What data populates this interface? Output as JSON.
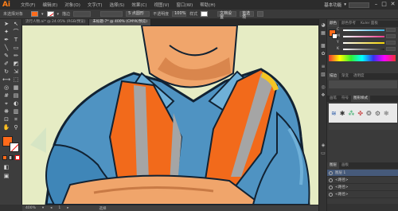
{
  "app": {
    "logo": "Ai"
  },
  "menubar": {
    "items": [
      "文件(F)",
      "编辑(E)",
      "对象(O)",
      "文字(T)",
      "选择(S)",
      "效果(C)",
      "视图(V)",
      "窗口(W)",
      "帮助(H)"
    ],
    "workspace": "基本功能",
    "minimize": "–",
    "maximize": "□",
    "close": "✕"
  },
  "controlbar": {
    "selection_label": "未选择对象",
    "stroke_label": "描边",
    "stroke_width": "",
    "points": "5 点圆形",
    "opacity_label": "不透明度",
    "opacity_value": "100%",
    "style_label": "样式",
    "doc_setup": "文档设置",
    "prefs": "首选项",
    "colors": {
      "fill": "#ff6a1a",
      "stroke": "none"
    }
  },
  "tabs": [
    {
      "label": "流行人物.ai* @ 24.05% (RGB/预览)",
      "active": false
    },
    {
      "label": "未标题-7* @ 400% (CMYK/预览)",
      "active": true
    }
  ],
  "toolbar": {
    "tools": [
      "selection-tool",
      "direct-selection-tool",
      "magic-wand-tool",
      "lasso-tool",
      "pen-tool",
      "type-tool",
      "line-tool",
      "rectangle-tool",
      "paintbrush-tool",
      "pencil-tool",
      "blob-brush-tool",
      "eraser-tool",
      "rotate-tool",
      "scale-tool",
      "width-tool",
      "free-transform-tool",
      "shape-builder-tool",
      "perspective-grid-tool",
      "mesh-tool",
      "gradient-tool",
      "eyedropper-tool",
      "blend-tool",
      "symbol-sprayer-tool",
      "column-graph-tool",
      "artboard-tool",
      "slice-tool",
      "hand-tool",
      "zoom-tool"
    ],
    "fill_color": "#ff6a1a"
  },
  "statusbar": {
    "zoom": "400%",
    "page": "1",
    "mode": "选择"
  },
  "panels": {
    "color_tabs": [
      "颜色",
      "颜色参考",
      "Kuler 面板"
    ],
    "color": {
      "fill": "#ff6a1a",
      "sliders": [
        "C",
        "M",
        "Y",
        "K"
      ],
      "slider_colors": [
        "#39b4e6",
        "#e93a89",
        "#f6d400",
        "#222222"
      ]
    },
    "brush_tabs": [
      "描边",
      "渐变",
      "透明度"
    ],
    "graphic_tabs": [
      "画笔",
      "符号",
      "图形样式"
    ],
    "layer_tabs": [
      "图层",
      "画板"
    ],
    "layers": [
      {
        "name": "图层 1"
      },
      {
        "name": "<路径>"
      },
      {
        "name": "<路径>"
      },
      {
        "name": "<路径>"
      }
    ]
  }
}
